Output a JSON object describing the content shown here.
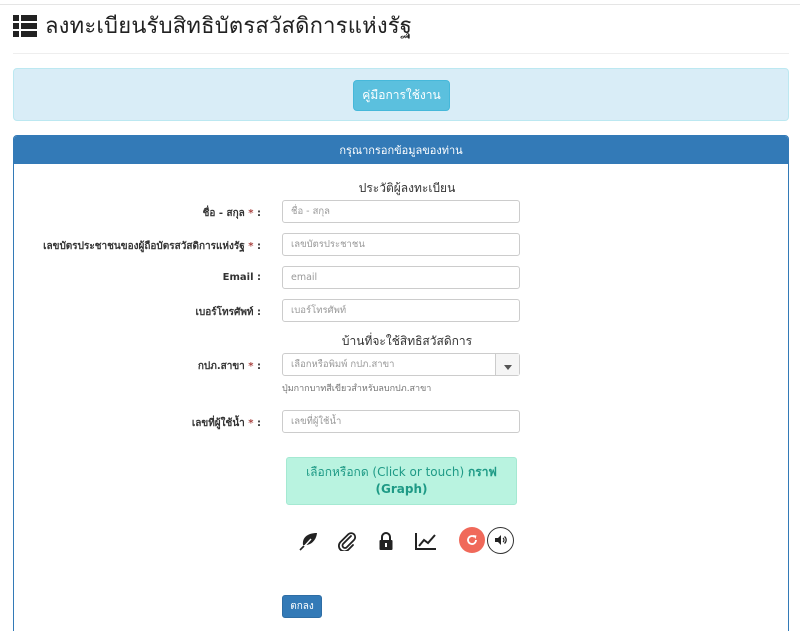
{
  "header": {
    "title": "ลงทะเบียนรับสิทธิบัตรสวัสดิการแห่งรัฐ",
    "icon": "list-icon"
  },
  "manual": {
    "button_label": "คู่มือการใช้งาน"
  },
  "form": {
    "heading": "กรุณากรอกข้อมูลของท่าน",
    "section_profile": "ประวัติผู้ลงทะเบียน",
    "section_home": "บ้านที่จะใช้สิทธิสวัสดิการ",
    "required_mark": "*",
    "fields": {
      "name": {
        "label": "ชื่อ - สกุล",
        "placeholder": "ชื่อ - สกุล"
      },
      "id_card": {
        "label": "เลขบัตรประชาชนของผู้ถือบัตรสวัสดิการแห่งรัฐ",
        "placeholder": "เลขบัตรประชาชน"
      },
      "email": {
        "label": "Email :",
        "placeholder": "email"
      },
      "phone": {
        "label": "เบอร์โทรศัพท์ :",
        "placeholder": "เบอร์โทรศัพท์"
      },
      "branch": {
        "label": "กปภ.สาขา",
        "placeholder": "เลือกหรือพิมพ์ กปภ.สาขา",
        "help": "ปุ่มกากบาทสีเขียวสำหรับลบกปภ.สาขา"
      },
      "water_user": {
        "label": "เลขที่ผู้ใช้น้ำ",
        "placeholder": "เลขที่ผู้ใช้น้ำ"
      }
    },
    "colon": ":",
    "captcha": {
      "line1_prefix": "เลือกหรือกด (Click or touch)",
      "line1_bold": "กราฟ",
      "line2_bold": "(Graph)",
      "icons": [
        "leaf-icon",
        "paperclip-icon",
        "lock-icon",
        "line-graph-icon"
      ],
      "refresh_icon": "refresh-icon",
      "sound_icon": "speaker-icon"
    },
    "submit_label": "ตกลง"
  },
  "colors": {
    "primary": "#337ab7",
    "info_bg": "#d9edf7",
    "info_btn": "#5bc0de",
    "captcha_bg": "#b9f3e0",
    "captcha_text": "#1e9a86",
    "refresh": "#f0695a",
    "required": "#a94442"
  }
}
